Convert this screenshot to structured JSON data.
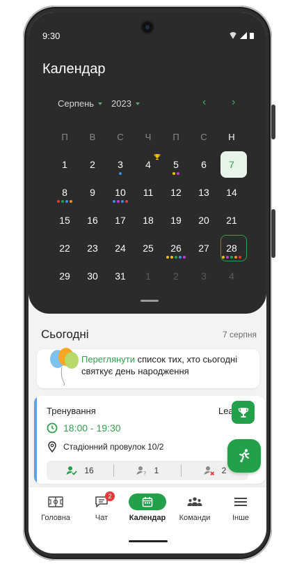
{
  "status_bar": {
    "time": "9:30"
  },
  "calendar": {
    "title": "Календар",
    "month": "Серпень",
    "year": "2023",
    "prev_arrow": "‹",
    "next_arrow": "›",
    "weekdays": [
      "П",
      "В",
      "С",
      "Ч",
      "П",
      "С",
      "Н"
    ],
    "weeks": [
      [
        {
          "d": "1"
        },
        {
          "d": "2"
        },
        {
          "d": "3",
          "dots": [
            "#3a8ee6"
          ]
        },
        {
          "d": "4",
          "trophy": true
        },
        {
          "d": "5",
          "dots": [
            "#f2c100",
            "#c03bd6"
          ]
        },
        {
          "d": "6"
        },
        {
          "d": "7",
          "today": true
        }
      ],
      [
        {
          "d": "8",
          "dots": [
            "#e23b3b",
            "#22a04a",
            "#3a8ee6",
            "#f28c1c"
          ]
        },
        {
          "d": "9"
        },
        {
          "d": "10",
          "dots": [
            "#3a8ee6",
            "#c03bd6",
            "#3a8ee6",
            "#e23b3b"
          ]
        },
        {
          "d": "11"
        },
        {
          "d": "12"
        },
        {
          "d": "13"
        },
        {
          "d": "14"
        }
      ],
      [
        {
          "d": "15"
        },
        {
          "d": "16"
        },
        {
          "d": "17"
        },
        {
          "d": "18"
        },
        {
          "d": "19"
        },
        {
          "d": "20"
        },
        {
          "d": "21"
        }
      ],
      [
        {
          "d": "22"
        },
        {
          "d": "23"
        },
        {
          "d": "24"
        },
        {
          "d": "25"
        },
        {
          "d": "26",
          "dots": [
            "#f2c100",
            "#f2c100",
            "#22a04a",
            "#3a8ee6",
            "#c03bd6"
          ]
        },
        {
          "d": "27"
        },
        {
          "d": "28",
          "selected": true,
          "dots": [
            "#f2c100",
            "#c03bd6",
            "#22a04a",
            "#f28c1c",
            "#e23b3b"
          ]
        }
      ],
      [
        {
          "d": "29"
        },
        {
          "d": "30"
        },
        {
          "d": "31"
        },
        {
          "d": "1",
          "dim": true
        },
        {
          "d": "2",
          "dim": true
        },
        {
          "d": "3",
          "dim": true
        },
        {
          "d": "4",
          "dim": true
        }
      ]
    ]
  },
  "today_section": {
    "heading": "Сьогодні",
    "date": "7 серпня",
    "birthday_link": "Переглянути",
    "birthday_text": " список тих, хто сьогодні святкує день народження"
  },
  "event": {
    "title": "Тренування",
    "tag": "Lea",
    "time": "18:00 - 19:30",
    "location": "Стадіонний провулок 10/2",
    "going": "16",
    "maybe": "1",
    "not_going": "2"
  },
  "bottom_nav": {
    "items": [
      {
        "label": "Головна",
        "icon": "field-icon"
      },
      {
        "label": "Чат",
        "icon": "chat-icon",
        "badge": "2"
      },
      {
        "label": "Календар",
        "icon": "calendar-icon",
        "active": true
      },
      {
        "label": "Команди",
        "icon": "team-icon"
      },
      {
        "label": "Інше",
        "icon": "menu-icon"
      }
    ]
  },
  "colors": {
    "accent": "#22a04a",
    "event_accent": "#5aa0f2",
    "panel": "#2b2b2b"
  }
}
